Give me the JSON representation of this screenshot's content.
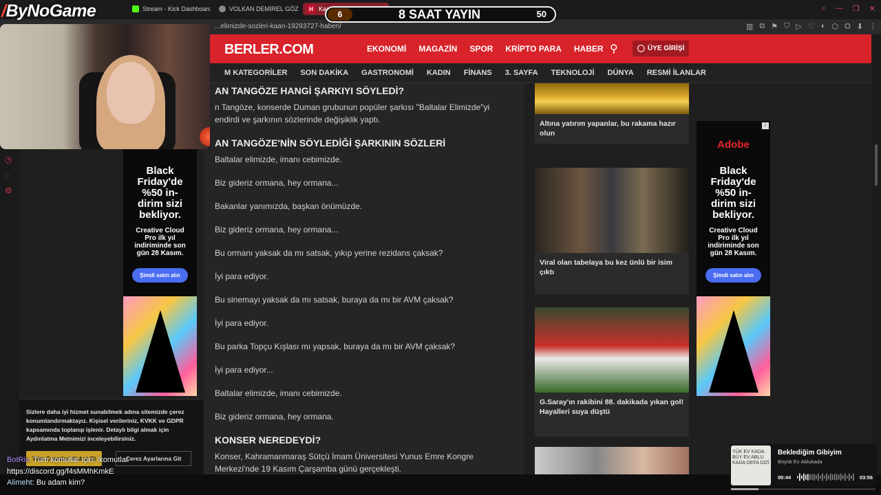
{
  "browser": {
    "tabs": [
      {
        "label": "Stream - Kick Dashboard",
        "icon": "kick-icon"
      },
      {
        "label": "VOLKAN DEMİREL GÖZLÜ",
        "icon": "chrome-icon"
      },
      {
        "label": "Kaa... bat... ele...",
        "icon": "haberler-icon"
      }
    ],
    "url": "...elimizde-sozleri-kaan-19293727-haberi/",
    "window_controls": [
      "⌕",
      "—",
      "❐",
      "✕"
    ],
    "toolbar_icons": [
      "▥",
      "⧉",
      "⚑",
      "⛉",
      "▷",
      "♡",
      "◐",
      "⬡",
      "⛭",
      "⬇",
      "⋮"
    ]
  },
  "site": {
    "logo": "BERLER.COM",
    "nav": [
      "EKONOMİ",
      "MAGAZİN",
      "SPOR",
      "KRİPTO PARA",
      "HABER"
    ],
    "login": "ÜYE GİRİŞİ",
    "subnav": [
      "M KATEGORİLER",
      "SON DAKİKA",
      "GASTRONOMİ",
      "KADIN",
      "FİNANS",
      "3. SAYFA",
      "TEKNOLOJİ",
      "DÜNYA",
      "RESMİ İLANLAR"
    ]
  },
  "article": {
    "h1": "AN TANGÖZE HANGİ ŞARKIYI SÖYLEDİ?",
    "intro1": "n Tangöze, konserde Duman grubunun popüler şarkısı \"Baltalar Elimizde\"yi",
    "intro2": "endirdi ve şarkının sözlerinde değişiklik yaptı.",
    "h2": "AN TANGÖZE'NİN SÖYLEDİĞİ ŞARKININ SÖZLERİ",
    "lyrics": [
      "Baltalar elimizde, imanı cebimizde.",
      "Biz gideriz ormana, hey ormana...",
      "Bakanlar yanımızda, başkan önümüzde.",
      "Biz gideriz ormana, hey ormana...",
      "Bu ormanı yaksak da mı satsak, yıkıp yerine rezidans çaksak?",
      "İyi para ediyor.",
      "Bu sinemayı yaksak da mı satsak, buraya da mı bir AVM çaksak?",
      "İyi para ediyor.",
      "Bu parka Topçu Kışlası mı yapsak, buraya da mı bir AVM çaksak?",
      "İyi para ediyor...",
      "Baltalar elimizde, imanı cebimizde.",
      "Biz gideriz ormana, hey ormana."
    ],
    "h3": "KONSER NEREDEYDİ?",
    "outro1": "Konser, Kahramanmaraş Sütçü İmam Üniversitesi Yunus Emre Kongre",
    "outro2": "Merkezi'nde 19 Kasım Çarşamba günü gerçekleşti."
  },
  "ad": {
    "brand": "Adobe",
    "headline": "Black Friday'de %50 in- dirim sizi bekliyor.",
    "headline_lines": [
      "Black",
      "Friday'de",
      "%50 in-",
      "dirim sizi",
      "bekliyor."
    ],
    "sub_lines": [
      "Creative Cloud",
      "Pro ilk yıl",
      "indiriminde son",
      "gün 28 Kasım."
    ],
    "cta": "Şimdi satın alın"
  },
  "side_cards": [
    {
      "title": "Altına yatırım yapanlar, bu rakama hazır olun"
    },
    {
      "title": "Viral olan tabelaya bu kez ünlü bir isim çıktı"
    },
    {
      "title": "G.Saray'ın rakibini 88. dakikada yıkan gol! Hayalleri suya düştü"
    }
  ],
  "cookie": {
    "text": "Sizlere daha iyi hizmet sunabilmek adına sitemizde çerez konumlandırmaktayız. Kişisel verileriniz, KVKK ve GDPR kapsamında toplanıp işlenir. Detaylı bilgi almak için Aydınlatma Metnimizi inceleyebilirsiniz.",
    "accept": "Tüm Çerezleri Kabul Et",
    "settings": "Çerez Ayarlarına Git"
  },
  "overlay": {
    "brand": "ByNoGame",
    "counter_left": "6",
    "counter_label": "8 SAAT YAYIN",
    "counter_right": "50",
    "counter_progress": 0.12
  },
  "chat": [
    {
      "user": "BotRix",
      "message": "Tüm komutlar için; !komutlar"
    },
    {
      "user": "",
      "message": "https://discord.gg/f4sMMhKmkE"
    },
    {
      "user": "Alimeht",
      "message": "Bu adam kim?"
    }
  ],
  "music": {
    "title": "Beklediğim Gibiyim",
    "artist": "Büyük Ev Ablukada",
    "current": "00:44",
    "total": "03:56",
    "progress": 0.19,
    "album_text": "YÜK EV KADA BÜY EV ABLU KADA DEFA DİZİ"
  },
  "colors": {
    "brand_red": "#d8232a",
    "ad_blue": "#4a6cf0",
    "cookie_gold": "#c9a227"
  }
}
